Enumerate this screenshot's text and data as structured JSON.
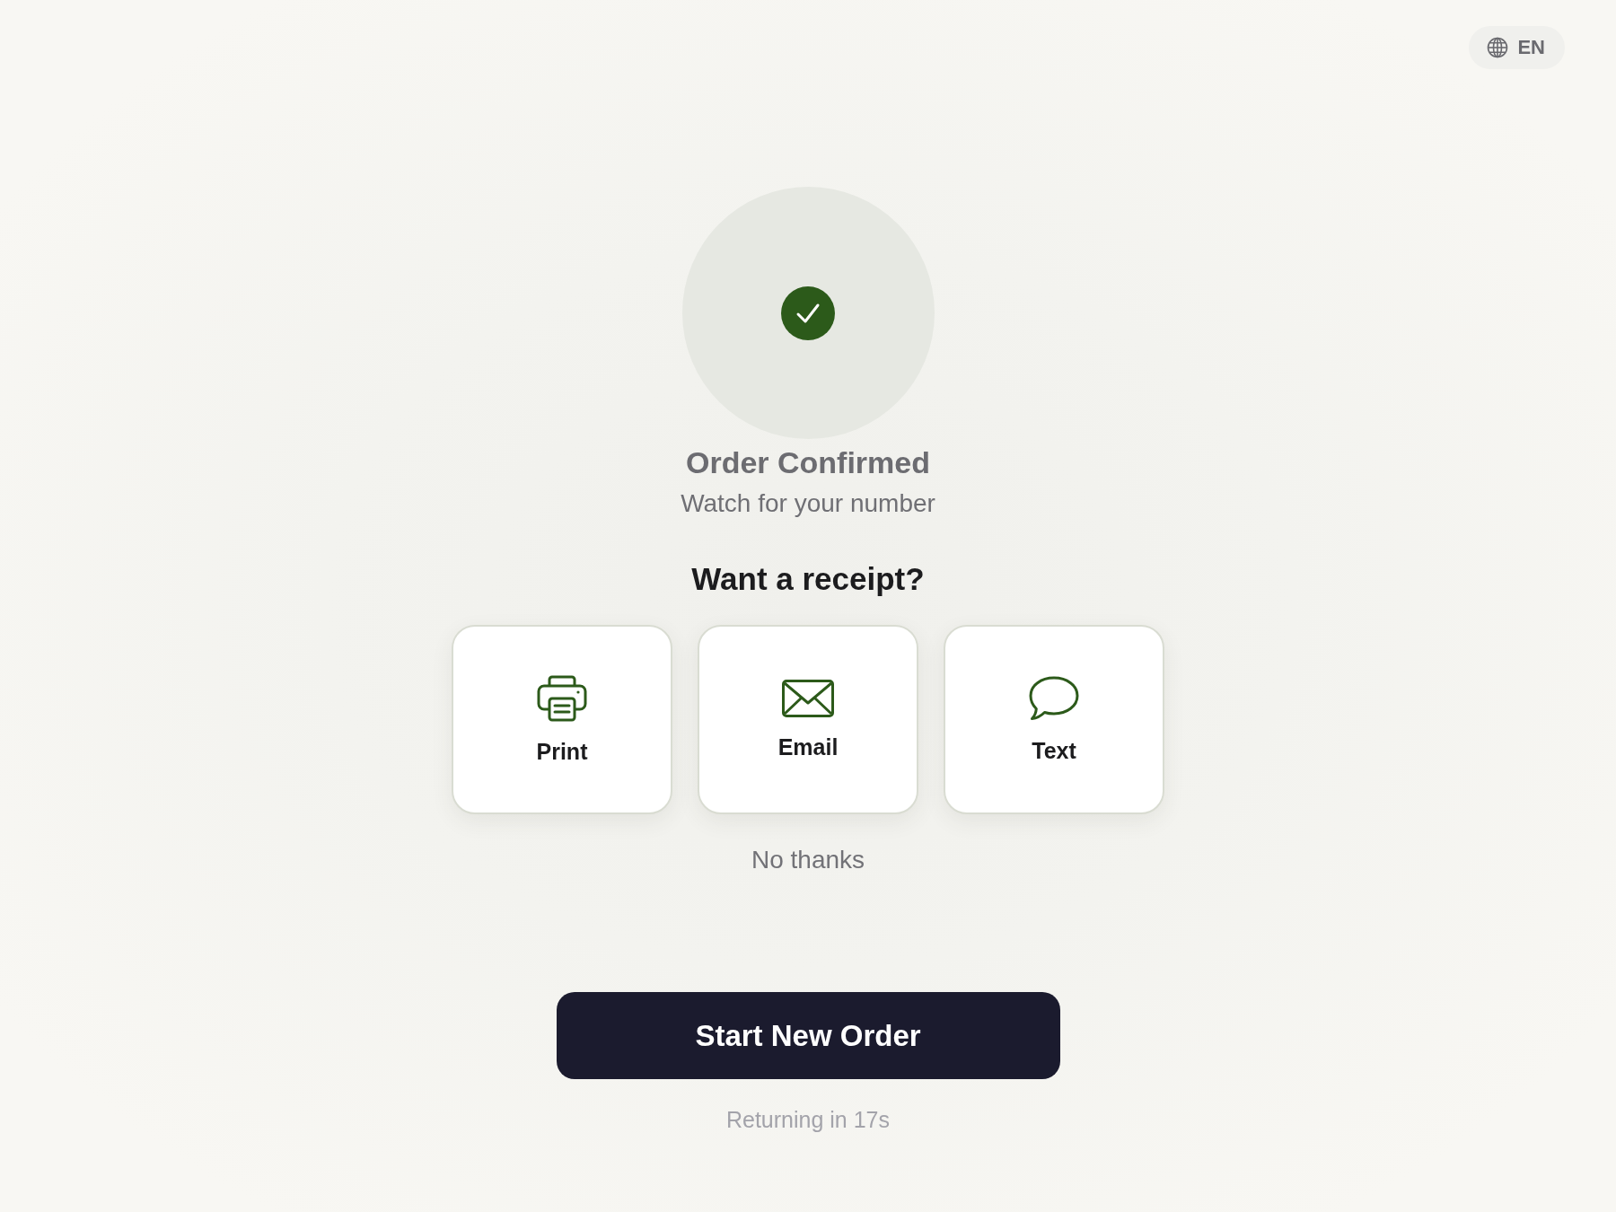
{
  "language_button": {
    "label": "EN"
  },
  "status": {
    "title": "Order Confirmed",
    "subtitle": "Watch for your number"
  },
  "receipt": {
    "question": "Want a receipt?",
    "options": [
      {
        "kind": "print",
        "label": "Print"
      },
      {
        "kind": "email",
        "label": "Email"
      },
      {
        "kind": "text",
        "label": "Text"
      }
    ],
    "decline": "No thanks"
  },
  "primary_action": {
    "label": "Start New Order"
  },
  "countdown": "Returning in 17s"
}
